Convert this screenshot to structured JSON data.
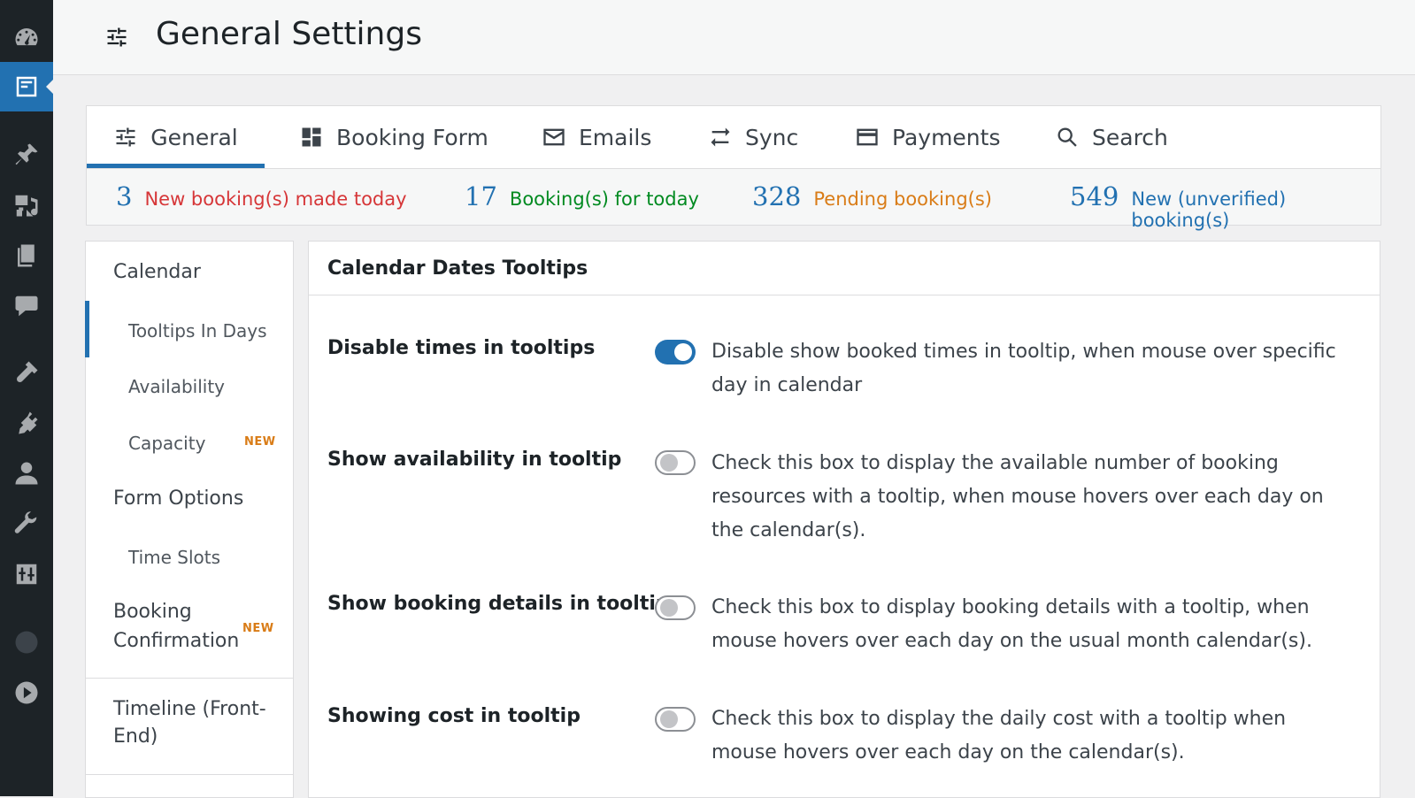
{
  "header": {
    "title": "General Settings",
    "icon": "sliders-icon"
  },
  "tabs": [
    {
      "label": "General",
      "icon": "sliders-icon",
      "active": true
    },
    {
      "label": "Booking Form",
      "icon": "dashboard-grid-icon",
      "active": false
    },
    {
      "label": "Emails",
      "icon": "mail-icon",
      "active": false
    },
    {
      "label": "Sync",
      "icon": "sync-arrows-icon",
      "active": false
    },
    {
      "label": "Payments",
      "icon": "credit-card-icon",
      "active": false
    },
    {
      "label": "Search",
      "icon": "search-icon",
      "active": false
    }
  ],
  "stats": [
    {
      "count": "3",
      "label": "New booking(s) made today",
      "color": "#d63638"
    },
    {
      "count": "17",
      "label": "Booking(s) for today",
      "color": "#008a20"
    },
    {
      "count": "328",
      "label": "Pending booking(s)",
      "color": "#d97c17"
    },
    {
      "count": "549",
      "label": "New (unverified) booking(s)",
      "color": "#2271b1"
    }
  ],
  "leftnav": {
    "calendar": "Calendar",
    "tooltips_in_days": "Tooltips In Days",
    "availability": "Availability",
    "capacity": "Capacity",
    "capacity_badge": "NEW",
    "form_options": "Form Options",
    "time_slots": "Time Slots",
    "booking_confirmation_line1": "Booking",
    "booking_confirmation_line2": "Confirmation",
    "booking_confirmation_badge": "NEW",
    "timeline_line1": "Timeline (Front-",
    "timeline_line2": "End)"
  },
  "panel": {
    "title": "Calendar Dates Tooltips",
    "rows": [
      {
        "label": "Disable times in tooltips",
        "enabled": true,
        "description": "Disable show booked times in tooltip, when mouse over specific day in calendar"
      },
      {
        "label": "Show availability in tooltip",
        "enabled": false,
        "description": "Check this box to display the available number of booking resources with a tooltip, when mouse hovers over each day on the calendar(s)."
      },
      {
        "label": "Show booking details in tooltip",
        "enabled": false,
        "description": "Check this box to display booking details with a tooltip, when mouse hovers over each day on the usual month calendar(s)."
      },
      {
        "label": "Showing cost in tooltip",
        "enabled": false,
        "description": "Check this box to display the daily cost with a tooltip when mouse hovers over each day on the calendar(s)."
      }
    ]
  },
  "adminbar_icons": [
    "dashboard-icon",
    "booking-calendar-icon",
    "pin-icon",
    "media-icon",
    "pages-icon",
    "comments-icon",
    "appearance-icon",
    "plugins-icon",
    "users-icon",
    "tools-icon",
    "settings-icon",
    "globe-icon",
    "play-icon"
  ],
  "colors": {
    "accent": "#2271b1",
    "adminbar": "#1d2327"
  }
}
